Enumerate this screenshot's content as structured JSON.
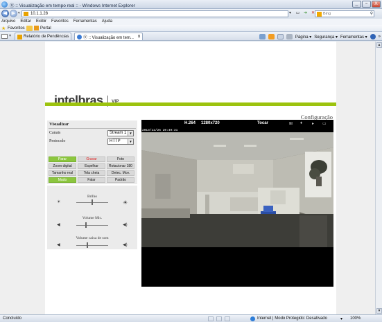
{
  "window": {
    "title": "Ⓥ :: Visualização em tempo real :: - Windows Internet Explorer",
    "min": "_",
    "max": "▫",
    "close": "X"
  },
  "address": {
    "url": "10.1.1.28",
    "search_placeholder": "Bing",
    "nav_drop": "▾"
  },
  "menu": [
    "Arquivo",
    "Editar",
    "Exibir",
    "Favoritos",
    "Ferramentas",
    "Ajuda"
  ],
  "favorites": {
    "label": "Favoritos",
    "portal": "Portal"
  },
  "tabs": [
    {
      "label": "Relatório de Pendências"
    },
    {
      "label": "Ⓥ :: Visualização em tem...",
      "close": "x"
    }
  ],
  "commands": {
    "page": "Página ▾",
    "security": "Segurança ▾",
    "tools": "Ferramentas ▾",
    "more": "»"
  },
  "logo": {
    "brand": "intelbras",
    "vip": "VIP"
  },
  "config_link": "Configuração",
  "panel": {
    "title": "Visualizar",
    "canal_label": "Canais",
    "canal_value": "Stream 1",
    "protocolo_label": "Protocolo",
    "protocolo_value": "HTTP",
    "buttons": {
      "parar": "Parar",
      "gravar": "Gravar",
      "foto": "Foto",
      "zoom": "Zoom digital",
      "espelhar": "Espelhar",
      "rotacionar": "Rotacionar 180",
      "tamanho": "Tamanho real",
      "tela": "Tela cheia",
      "detec": "Detec. Mov.",
      "mudo": "Mudo",
      "falar": "Falar",
      "padrao": "Padrão"
    },
    "brilho_label": "Brilho",
    "mic_label": "Volume Mic.",
    "caixa_label": "Volume caixa de som",
    "brilho_value": 0.5,
    "mic_value": 0.3,
    "caixa_value": 0.35
  },
  "video": {
    "codec": "H.264",
    "resolution": "1280x720",
    "play": "Tocar",
    "timestamp": "2013/12/25 20:49:31"
  },
  "status": {
    "text": "Concluído",
    "zone": "Internet | Modo Protegido: Desativado",
    "zoom": "100%"
  },
  "colors": {
    "accent_green": "#9cc30e",
    "button_green": "#8cc63f",
    "record_red": "#e02020"
  }
}
